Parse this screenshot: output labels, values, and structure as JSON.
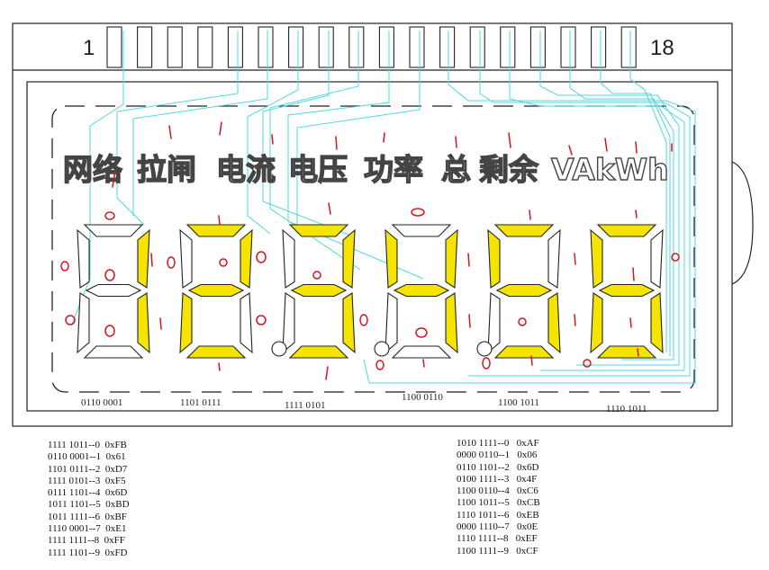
{
  "connector": {
    "pin_first": "1",
    "pin_last": "18"
  },
  "icons": [
    {
      "label": "网络"
    },
    {
      "label": "拉闸"
    },
    {
      "label": "电流"
    },
    {
      "label": "电压"
    },
    {
      "label": "功率"
    },
    {
      "label": "总"
    },
    {
      "label": "剩余"
    },
    {
      "label": "VAkWh"
    }
  ],
  "digits": [
    {
      "bits": "0110 0001",
      "lit": [
        "b",
        "c"
      ],
      "dp": false
    },
    {
      "bits": "1101 0111",
      "lit": [
        "a",
        "b",
        "g",
        "e",
        "d"
      ],
      "dp": false
    },
    {
      "bits": "1111 0101",
      "lit": [
        "a",
        "b",
        "g",
        "c",
        "d"
      ],
      "dp": true
    },
    {
      "bits": "1100 0110",
      "lit": [
        "f",
        "g",
        "b",
        "c"
      ],
      "dp": true
    },
    {
      "bits": "1100 1011",
      "lit": [
        "a",
        "f",
        "g",
        "c",
        "d"
      ],
      "dp": true
    },
    {
      "bits": "1110 1011",
      "lit": [
        "a",
        "f",
        "g",
        "e",
        "c",
        "d"
      ],
      "dp": false
    }
  ],
  "table_left": [
    "1111 1011--0  0xFB",
    "0110 0001--1  0x61",
    "1101 0111--2  0xD7",
    "1111 0101--3  0xF5",
    "0111 1101--4  0x6D",
    "1011 1101--5  0xBD",
    "1011 1111--6  0xBF",
    "1110 0001--7  0xE1",
    "1111 1111--8  0xFF",
    "1111 1101--9  0xFD"
  ],
  "table_right": [
    "1010 1111--0   0xAF",
    "0000 0110--1   0x06",
    "0110 1101--2   0x6D",
    "0100 1111--3   0x4F",
    "1100 0110--4   0xC6",
    "1100 1011--5   0xCB",
    "1110 1011--6   0xEB",
    "0000 1110--7   0x0E",
    "1110 1111--8   0xEF",
    "1100 1111--9   0xCF"
  ],
  "colors": {
    "segment_on": "#f5e400",
    "wire": "#4fd8e0",
    "annotation": "#d4151f",
    "outline": "#222222"
  }
}
